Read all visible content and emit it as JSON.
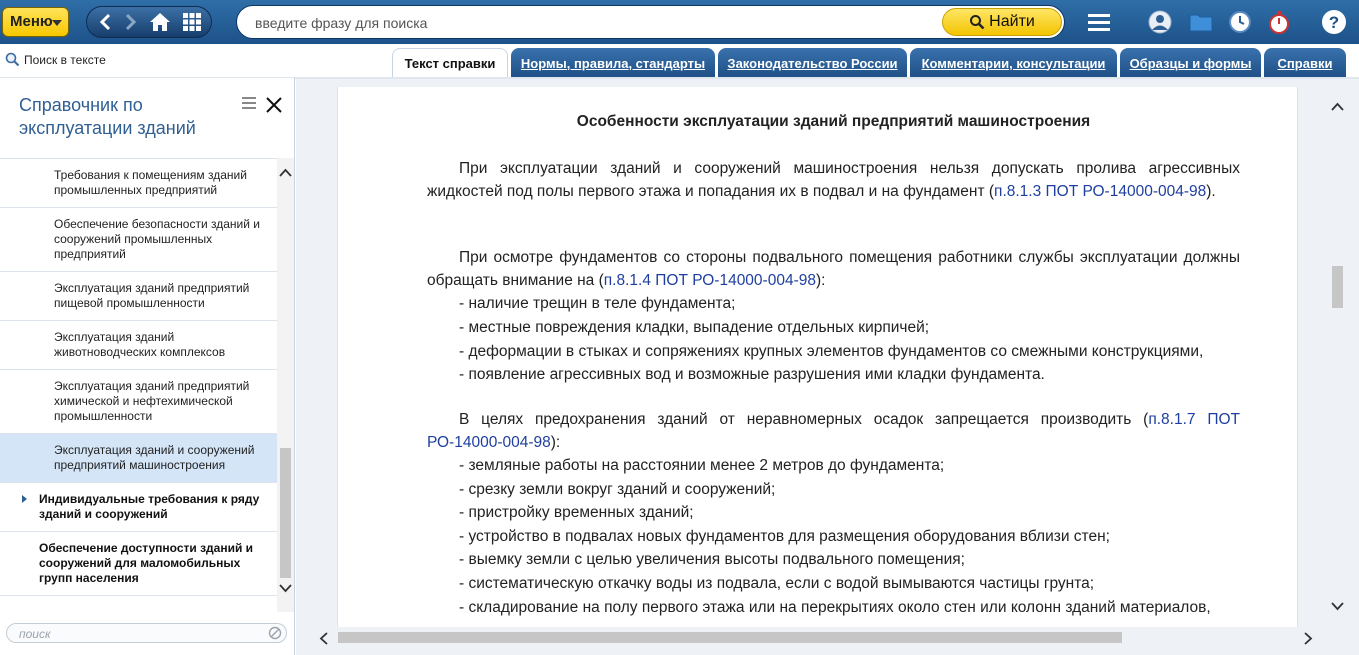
{
  "topbar": {
    "menu_label": "Меню",
    "search_placeholder": "введите фразу для поиска",
    "find_label": "Найти",
    "icons": [
      "back-icon",
      "forward-icon",
      "home-icon",
      "grid-icon",
      "hamburger-icon",
      "user-icon",
      "folder-icon",
      "history-clock-icon",
      "stopwatch-icon",
      "help-icon"
    ],
    "accent": "#1d5289",
    "button_color": "#f6c800"
  },
  "search_in_text_label": "Поиск в тексте",
  "tabs": [
    {
      "label": "Текст справки",
      "active": true
    },
    {
      "label": "Нормы, правила, стандарты"
    },
    {
      "label": "Законодательство России"
    },
    {
      "label": "Комментарии, консультации"
    },
    {
      "label": "Образцы и формы"
    },
    {
      "label": "Справки"
    }
  ],
  "sidebar": {
    "title": "Справочник по эксплуатации зданий",
    "items": [
      {
        "label": "Требования к помещениям зданий промышленных предприятий"
      },
      {
        "label": "Обеспечение безопасности зданий и сооружений промышленных предприятий"
      },
      {
        "label": "Эксплуатация зданий предприятий пищевой промышленности"
      },
      {
        "label": "Эксплуатация зданий животноводческих комплексов"
      },
      {
        "label": "Эксплуатация зданий предприятий химической и нефтехимической промышленности"
      },
      {
        "label": "Эксплуатация зданий и сооружений предприятий машиностроения",
        "selected": true
      },
      {
        "label": "Индивидуальные требования к ряду зданий и сооружений",
        "bold": true,
        "expandable": true
      },
      {
        "label": "Обеспечение доступности зданий и сооружений для маломобильных групп населения",
        "bold": true
      }
    ],
    "search_placeholder": "поиск"
  },
  "document": {
    "heading": "Особенности эксплуатации зданий предприятий машиностроения",
    "p1_text": "При эксплуатации зданий и сооружений машиностроения нельзя допускать пролива агрессивных жидкостей под полы первого этажа и попадания их в подвал и на фундамент (",
    "p1_ref": "п.8.1.3 ПОТ РО-14000-004-98",
    "p1_end": ").",
    "p2_text": "При осмотре фундаментов со стороны подвального помещения работники службы эксплуатации должны обращать внимание на (",
    "p2_ref": "п.8.1.4 ПОТ РО-14000-004-98",
    "p2_end": "):",
    "list1": [
      "- наличие трещин в теле фундамента;",
      "- местные повреждения кладки, выпадение отдельных кирпичей;",
      "- деформации в стыках и сопряжениях крупных элементов фундаментов со смежными конструкциями,",
      "- появление агрессивных вод и возможные разрушения ими кладки фундамента."
    ],
    "p3_text": "В целях предохранения зданий от неравномерных осадок запрещается производить (",
    "p3_ref": "п.8.1.7 ПОТ РО-14000-004-98",
    "p3_end": "):",
    "list2": [
      "- земляные работы на расстоянии менее 2 метров до фундамента;",
      "- срезку земли вокруг зданий и сооружений;",
      "- пристройку временных зданий;",
      "- устройство в подвалах новых фундаментов для размещения оборудования вблизи стен;",
      "- выемку земли с целью увеличения высоты подвального помещения;",
      "- систематическую откачку воды из подвала, если с водой вымываются частицы грунта;",
      "- складирование на полу первого этажа или на перекрытиях около стен или колонн зданий материалов,"
    ]
  }
}
